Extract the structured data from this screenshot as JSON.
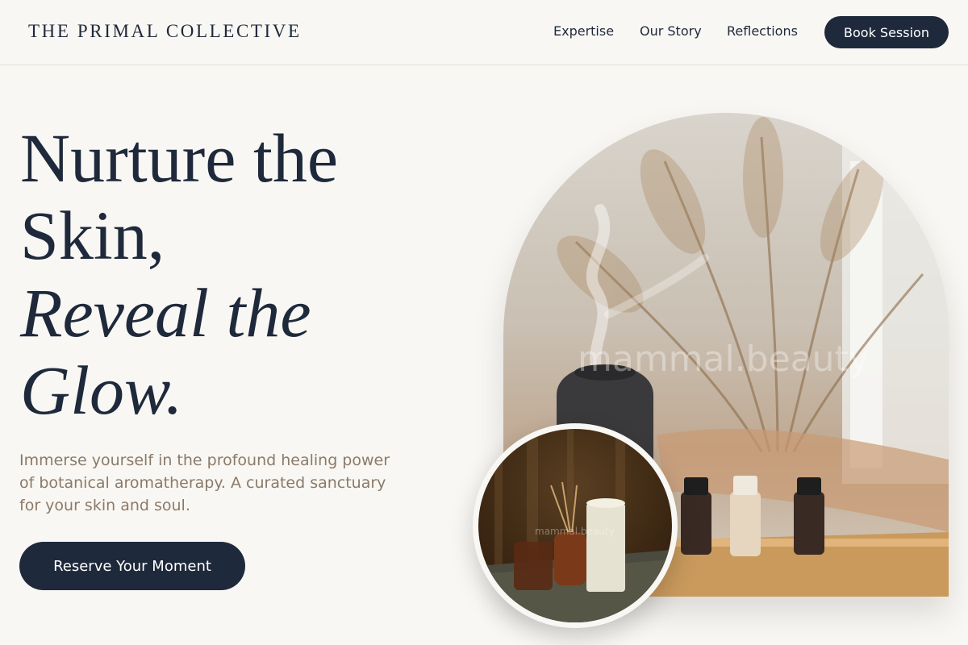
{
  "header": {
    "brand": "THE PRIMAL COLLECTIVE",
    "nav": {
      "expertise": "Expertise",
      "our_story": "Our Story",
      "reflections": "Reflections"
    },
    "book_button": "Book Session"
  },
  "hero": {
    "headline_line1": "Nurture the",
    "headline_line2": "Skin,",
    "headline_line3": "Reveal the",
    "headline_line4": "Glow.",
    "description": "Immerse yourself in the profound healing power of botanical aromatherapy. A curated sanctuary for your skin and soul.",
    "cta_button": "Reserve Your Moment"
  },
  "images": {
    "arch_photo_watermark": "mammal.beauty",
    "circle_photo_watermark": "mammal.beauty"
  },
  "colors": {
    "background": "#f9f7f3",
    "primary": "#1e293b",
    "muted_text": "#8a7a6a"
  }
}
